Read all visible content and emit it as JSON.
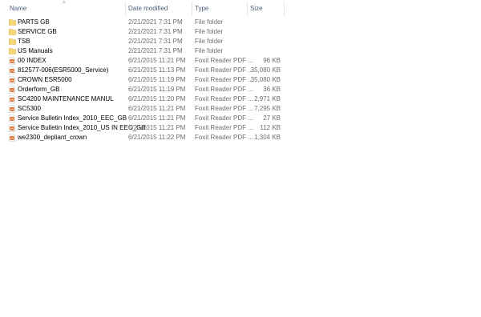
{
  "columns": {
    "name": "Name",
    "date_modified": "Date modified",
    "type": "Type",
    "size": "Size",
    "sort_indicator": "^"
  },
  "files": [
    {
      "name": "PARTS GB",
      "date": "2/21/2021 7:31 PM",
      "type": "File folder",
      "size": "",
      "icon": "folder-icon"
    },
    {
      "name": "SERVICE GB",
      "date": "2/21/2021 7:31 PM",
      "type": "File folder",
      "size": "",
      "icon": "folder-icon"
    },
    {
      "name": "TSB",
      "date": "2/21/2021 7:31 PM",
      "type": "File folder",
      "size": "",
      "icon": "folder-icon"
    },
    {
      "name": "US Manuals",
      "date": "2/21/2021 7:31 PM",
      "type": "File folder",
      "size": "",
      "icon": "folder-icon"
    },
    {
      "name": "00 INDEX",
      "date": "6/21/2015 11:21 PM",
      "type": "Foxit Reader PDF ...",
      "size": "96 KB",
      "icon": "pdf-icon"
    },
    {
      "name": "812577-006(ESR5000_Service)",
      "date": "6/21/2015 11:13 PM",
      "type": "Foxit Reader PDF ...",
      "size": "35,080 KB",
      "icon": "pdf-icon"
    },
    {
      "name": "CROWN ESR5000",
      "date": "6/21/2015 11:19 PM",
      "type": "Foxit Reader PDF ...",
      "size": "35,080 KB",
      "icon": "pdf-icon"
    },
    {
      "name": "Orderform_GB",
      "date": "6/21/2015 11:19 PM",
      "type": "Foxit Reader PDF ...",
      "size": "36 KB",
      "icon": "pdf-icon"
    },
    {
      "name": "SC4200 MAINTENANCE MANUL",
      "date": "6/21/2015 11:20 PM",
      "type": "Foxit Reader PDF ...",
      "size": "2,971 KB",
      "icon": "pdf-icon"
    },
    {
      "name": "SC5300",
      "date": "6/21/2015 11:21 PM",
      "type": "Foxit Reader PDF ...",
      "size": "7,295 KB",
      "icon": "pdf-icon"
    },
    {
      "name": "Service Bulletin Index_2010_EEC_GB",
      "date": "6/21/2015 11:21 PM",
      "type": "Foxit Reader PDF ...",
      "size": "27 KB",
      "icon": "pdf-icon"
    },
    {
      "name": "Service Bulletin Index_2010_US IN EEC_GB",
      "date": "6/21/2015 11:21 PM",
      "type": "Foxit Reader PDF ...",
      "size": "112 KB",
      "icon": "pdf-icon"
    },
    {
      "name": "we2300_depliant_crown",
      "date": "6/21/2015 11:22 PM",
      "type": "Foxit Reader PDF ...",
      "size": "1,304 KB",
      "icon": "pdf-icon"
    }
  ],
  "colors": {
    "header_text": "#4c607a",
    "detail_text": "#6d6d6d",
    "folder": "#f8d775",
    "pdf_accent": "#e0702b"
  }
}
